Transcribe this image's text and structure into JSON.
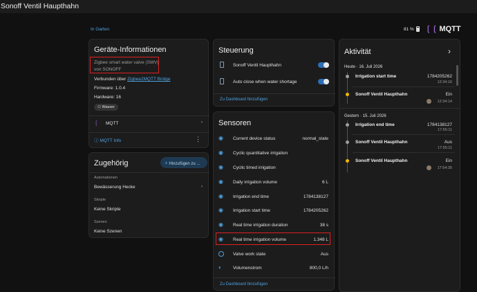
{
  "app": {
    "title": "Sonoff Ventil Haupthahn"
  },
  "header": {
    "area_link": "In Garten",
    "battery": "81 %",
    "brand_logo": "MQTT"
  },
  "device_info": {
    "title": "Geräte-Informationen",
    "model": "Zigbee smart water valve (SWV)",
    "manufacturer": "von SONOFF",
    "connected_via_prefix": "Verbunden über",
    "connected_via_link": "Zigbee2MQTT Bridge",
    "firmware": "Firmware: 1.0.4",
    "hardware": "Hardware: 16",
    "label_chip": "Wasser",
    "integration": "MQTT",
    "mqtt_info": "MQTT Info"
  },
  "related": {
    "title": "Zugehörig",
    "add_button": "Hinzufügen zu ...",
    "automations_heading": "Automationen",
    "automation_item": "Bewässerung Hecke",
    "scripts_heading": "Skripte",
    "scripts_none": "Keine Skripte",
    "scenes_heading": "Szenen",
    "scenes_none": "Keine Szenen"
  },
  "controls": {
    "title": "Steuerung",
    "items": [
      {
        "label": "Sonoff Ventil Haupthahn",
        "icon": "phone-device-icon"
      },
      {
        "label": "Auto close when water shortage",
        "icon": "phone-device-icon"
      }
    ],
    "add_dashboard": "Zu Dashboard hinzufügen"
  },
  "sensors": {
    "title": "Sensoren",
    "items": [
      {
        "label": "Current device status",
        "value": "normal_state"
      },
      {
        "label": "Cyclic quantitative irrigation",
        "value": ""
      },
      {
        "label": "Cyclic timed irrigation",
        "value": ""
      },
      {
        "label": "Daily irrigation volume",
        "value": "6 L"
      },
      {
        "label": "Irrigation end time",
        "value": "1784138127"
      },
      {
        "label": "Irrigation start time",
        "value": "1784205262"
      },
      {
        "label": "Real time irrigation duration",
        "value": "38 s"
      },
      {
        "label": "Real time irrigation volume",
        "value": "1.348 L"
      },
      {
        "label": "Valve work state",
        "value": "Aus"
      },
      {
        "label": "Volumenstrom",
        "value": "800,0 L/h"
      }
    ],
    "add_dashboard": "Zu Dashboard hinzufügen"
  },
  "activity": {
    "title": "Aktivität",
    "today_header": "Heute · 16. Juli 2026",
    "yesterday_header": "Gestern · 15. Juli 2026",
    "today": [
      {
        "title": "Irrigation start time",
        "value": "1784205262",
        "time": "12:34:16"
      },
      {
        "title": "Sonoff Ventil Haupthahn",
        "value": "Ein",
        "time": "12:34:14"
      }
    ],
    "yesterday": [
      {
        "title": "Irrigation end time",
        "value": "1784138127",
        "time": "17:55:11"
      },
      {
        "title": "Sonoff Ventil Haupthahn",
        "value": "Aus",
        "time": "17:55:11"
      },
      {
        "title": "Sonoff Ventil Haupthahn",
        "value": "Ein",
        "time": "17:54:35"
      }
    ]
  },
  "colors": {
    "accent": "#4fa3e0",
    "highlight": "#e02020",
    "on_dot": "#f2b705",
    "off_dot": "#9e9e9e"
  }
}
